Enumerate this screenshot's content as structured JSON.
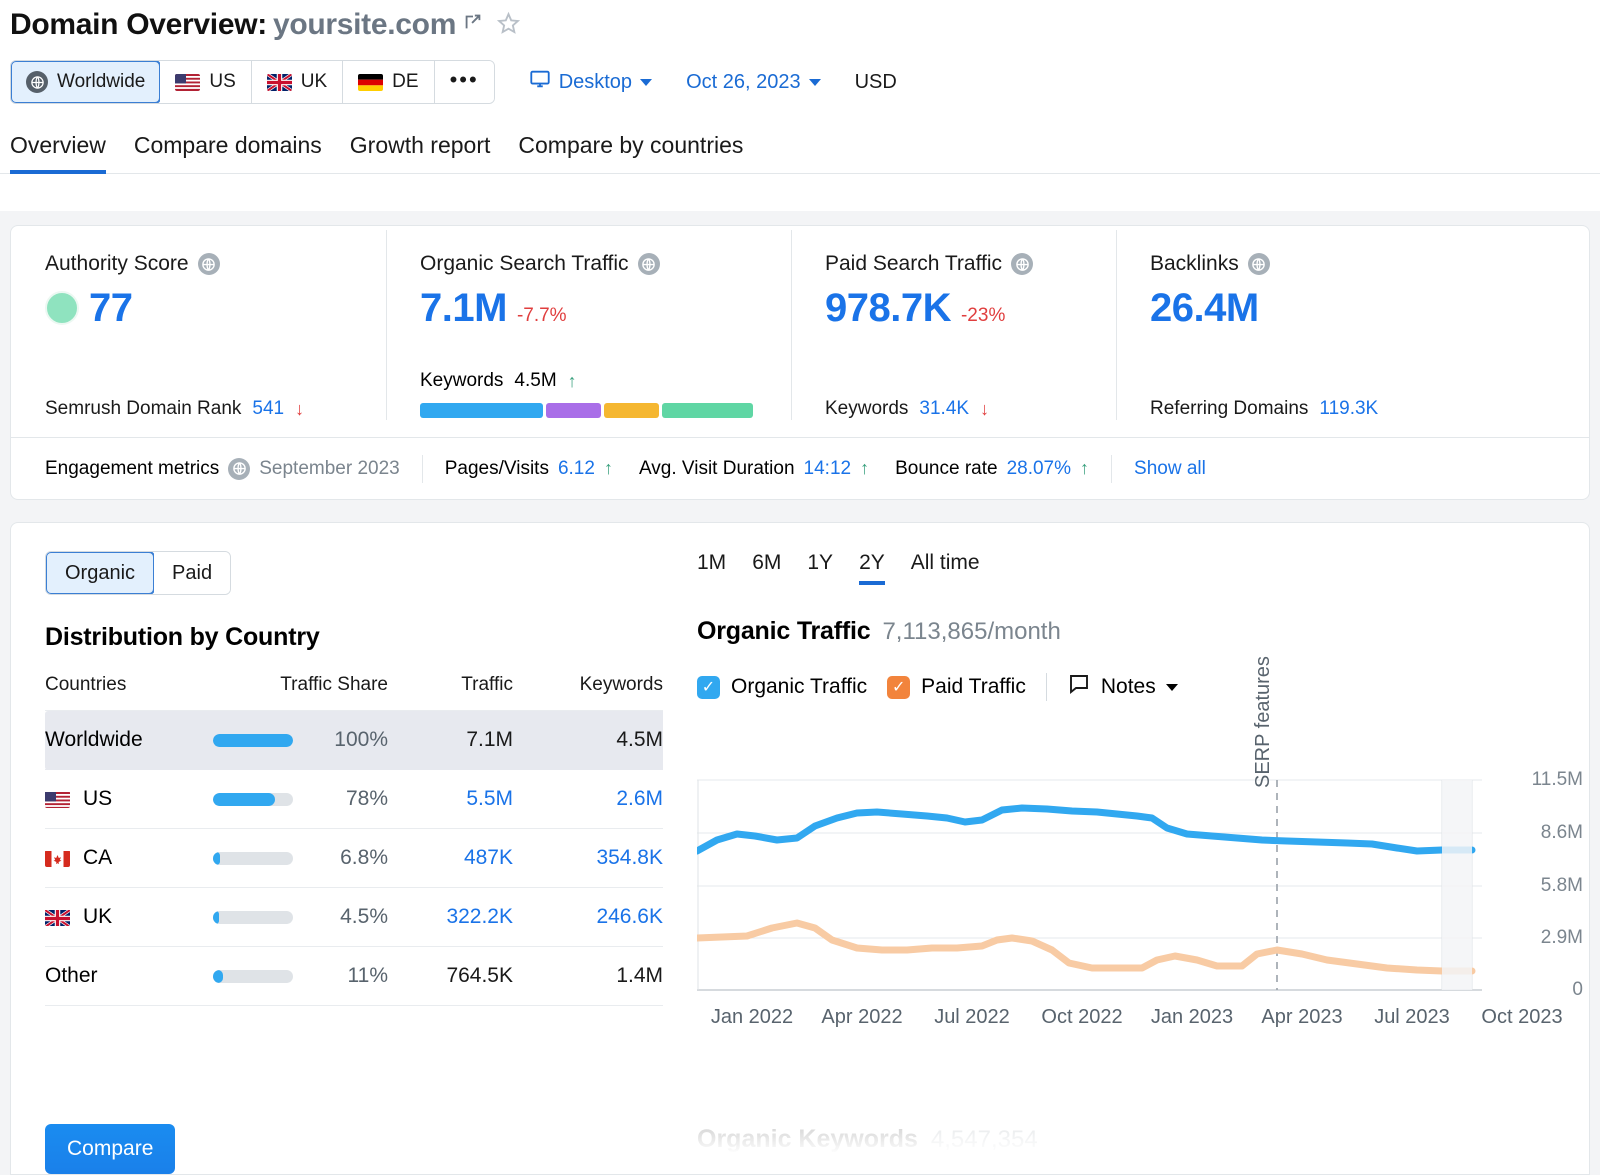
{
  "header": {
    "title_prefix": "Domain Overview:",
    "domain": "yoursite.com",
    "external_link_icon": "external-link-icon",
    "favorite_icon": "star-icon",
    "geo_items": [
      {
        "label": "Worldwide",
        "icon": "globe-icon",
        "active": true
      },
      {
        "label": "US",
        "icon": "flag-us",
        "active": false
      },
      {
        "label": "UK",
        "icon": "flag-uk",
        "active": false
      },
      {
        "label": "DE",
        "icon": "flag-de",
        "active": false
      },
      {
        "label": "•••",
        "icon": "more-icon",
        "active": false
      }
    ],
    "device": "Desktop",
    "date": "Oct 26, 2023",
    "currency": "USD"
  },
  "tabs": [
    {
      "label": "Overview",
      "active": true
    },
    {
      "label": "Compare domains",
      "active": false
    },
    {
      "label": "Growth report",
      "active": false
    },
    {
      "label": "Compare by countries",
      "active": false
    }
  ],
  "metrics": {
    "authority": {
      "label": "Authority Score",
      "value": "77",
      "sub_label": "Semrush Domain Rank",
      "sub_value": "541",
      "sub_trend": "↓"
    },
    "organic": {
      "label": "Organic Search Traffic",
      "value": "7.1M",
      "delta": "-7.7%",
      "kw_label": "Keywords",
      "kw_value": "4.5M",
      "kw_trend": "↑",
      "bar_segments": [
        {
          "color": "#31a8f0",
          "pct": 38
        },
        {
          "color": "#a96ee8",
          "pct": 17
        },
        {
          "color": "#f5b731",
          "pct": 17
        },
        {
          "color": "#5fd6a4",
          "pct": 28
        }
      ]
    },
    "paid": {
      "label": "Paid Search Traffic",
      "value": "978.7K",
      "delta": "-23%",
      "kw_label": "Keywords",
      "kw_value": "31.4K",
      "kw_trend": "↓"
    },
    "backlinks": {
      "label": "Backlinks",
      "value": "26.4M",
      "sub_label": "Referring Domains",
      "sub_value": "119.3K"
    }
  },
  "engagement": {
    "label": "Engagement metrics",
    "period": "September 2023",
    "pages_visits_label": "Pages/Visits",
    "pages_visits_value": "6.12",
    "pages_visits_trend": "↑",
    "duration_label": "Avg. Visit Duration",
    "duration_value": "14:12",
    "duration_trend": "↑",
    "bounce_label": "Bounce rate",
    "bounce_value": "28.07%",
    "bounce_trend": "↑",
    "show_all": "Show all"
  },
  "distribution": {
    "toggle": [
      {
        "label": "Organic",
        "active": true
      },
      {
        "label": "Paid",
        "active": false
      }
    ],
    "title": "Distribution by Country",
    "columns": [
      "Countries",
      "Traffic Share",
      "Traffic",
      "Keywords"
    ],
    "rows": [
      {
        "country": "Worldwide",
        "flag": "",
        "share_pct": "100%",
        "share_bar": 100,
        "traffic": "7.1M",
        "keywords": "4.5M",
        "link": false,
        "highlight": true
      },
      {
        "country": "US",
        "flag": "flag-us",
        "share_pct": "78%",
        "share_bar": 78,
        "traffic": "5.5M",
        "keywords": "2.6M",
        "link": true,
        "highlight": false
      },
      {
        "country": "CA",
        "flag": "flag-ca",
        "share_pct": "6.8%",
        "share_bar": 7,
        "traffic": "487K",
        "keywords": "354.8K",
        "link": true,
        "highlight": false
      },
      {
        "country": "UK",
        "flag": "flag-uk",
        "share_pct": "4.5%",
        "share_bar": 5,
        "traffic": "322.2K",
        "keywords": "246.6K",
        "link": true,
        "highlight": false
      },
      {
        "country": "Other",
        "flag": "",
        "share_pct": "11%",
        "share_bar": 10,
        "traffic": "764.5K",
        "keywords": "1.4M",
        "link": false,
        "highlight": false
      }
    ],
    "compare_button": "Compare"
  },
  "traffic_panel": {
    "ranges": [
      {
        "label": "1M",
        "active": false
      },
      {
        "label": "6M",
        "active": false
      },
      {
        "label": "1Y",
        "active": false
      },
      {
        "label": "2Y",
        "active": true
      },
      {
        "label": "All time",
        "active": false
      }
    ],
    "title": "Organic Traffic",
    "value": "7,113,865/month",
    "legend": [
      {
        "label": "Organic Traffic",
        "color": "#31a8f0",
        "checked": true
      },
      {
        "label": "Paid Traffic",
        "color": "#f2843c",
        "checked": true
      }
    ],
    "notes_label": "Notes",
    "notes_icon": "note-bubble-icon",
    "footer_title": "Organic Keywords",
    "footer_value": "4,547,354"
  },
  "chart_data": {
    "type": "line",
    "title": "Organic Traffic",
    "xlabel": "",
    "ylabel": "",
    "grid": true,
    "legend_position": "top",
    "ylim": [
      0,
      11500000
    ],
    "yticks": [
      0,
      2900000,
      5800000,
      8600000,
      11500000
    ],
    "ytick_labels": [
      "0",
      "2.9M",
      "5.8M",
      "8.6M",
      "11.5M"
    ],
    "xtick_labels": [
      "Jan 2022",
      "Apr 2022",
      "Jul 2022",
      "Oct 2022",
      "Jan 2023",
      "Apr 2023",
      "Jul 2023",
      "Oct 2023"
    ],
    "annotations": [
      {
        "text": "SERP features",
        "type": "vertical-dashed-line",
        "x": "Feb 2023",
        "rotated": true
      }
    ],
    "series": [
      {
        "name": "Organic Traffic",
        "color": "#31a8f0",
        "values": [
          7.6,
          7.9,
          8.2,
          8.0,
          8.1,
          8.6,
          9.1,
          9.3,
          9.2,
          9.0,
          9.2,
          9.6,
          9.5,
          9.4,
          9.3,
          9.0,
          8.3,
          8.2,
          8.1,
          8.0,
          7.9,
          7.6,
          7.4,
          7.1
        ],
        "unit": "M"
      },
      {
        "name": "Paid Traffic",
        "color": "#f8cba4",
        "values": [
          2.6,
          2.6,
          2.9,
          3.1,
          2.7,
          2.3,
          2.2,
          2.2,
          2.3,
          2.4,
          2.3,
          2.2,
          1.5,
          1.3,
          1.3,
          1.6,
          1.5,
          1.3,
          1.4,
          2.0,
          1.9,
          1.6,
          1.2,
          1.0
        ],
        "unit": "M"
      }
    ]
  }
}
